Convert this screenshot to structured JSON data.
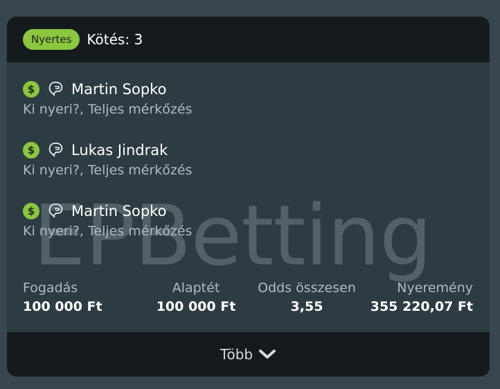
{
  "header": {
    "status_badge": "Nyertes",
    "title": "Kötés: 3"
  },
  "watermark": "EPBetting",
  "selections": [
    {
      "player": "Martin Sopko",
      "market": "Ki nyeri?, Teljes mérkőzés",
      "status_icon": "dollar-icon",
      "sport_icon": "boxing-glove-icon"
    },
    {
      "player": "Lukas Jindrak",
      "market": "Ki nyeri?, Teljes mérkőzés",
      "status_icon": "dollar-icon",
      "sport_icon": "boxing-glove-icon"
    },
    {
      "player": "Martin Sopko",
      "market": "Ki nyeri?, Teljes mérkőzés",
      "status_icon": "dollar-icon",
      "sport_icon": "boxing-glove-icon"
    }
  ],
  "stats": {
    "stake_label": "Fogadás",
    "stake_value": "100 000 Ft",
    "base_label": "Alaptét",
    "base_value": "100 000 Ft",
    "odds_label": "Odds összesen",
    "odds_value": "3,55",
    "payout_label": "Nyeremény",
    "payout_value": "355 220,07 Ft"
  },
  "footer": {
    "more_label": "Több"
  },
  "colors": {
    "accent": "#8cc63f",
    "background": "#38474f",
    "card": "#2d3b42",
    "bar": "#141a1d"
  }
}
